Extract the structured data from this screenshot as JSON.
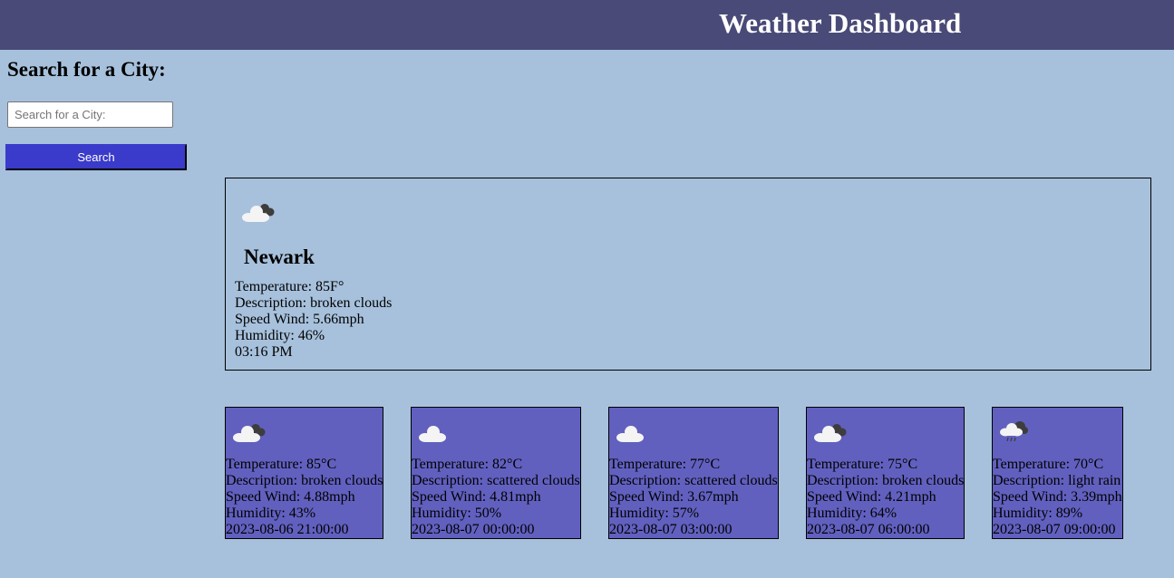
{
  "header": {
    "title": "Weather Dashboard"
  },
  "search": {
    "heading": "Search for a City:",
    "placeholder": "Search for a City:",
    "value": "",
    "button_label": "Search"
  },
  "current": {
    "icon": "broken-clouds-icon",
    "city": "Newark",
    "temperature": "Temperature: 85F°",
    "description": "Description: broken clouds",
    "wind": "Speed Wind: 5.66mph",
    "humidity": "Humidity: 46%",
    "time": "03:16 PM"
  },
  "forecast": [
    {
      "icon": "broken-clouds-icon",
      "temperature": "Temperature: 85°C",
      "description": "Description: broken clouds",
      "wind": "Speed Wind: 4.88mph",
      "humidity": "Humidity: 43%",
      "datetime": "2023-08-06 21:00:00"
    },
    {
      "icon": "scattered-clouds-icon",
      "temperature": "Temperature: 82°C",
      "description": "Description: scattered clouds",
      "wind": "Speed Wind: 4.81mph",
      "humidity": "Humidity: 50%",
      "datetime": "2023-08-07 00:00:00"
    },
    {
      "icon": "scattered-clouds-icon",
      "temperature": "Temperature: 77°C",
      "description": "Description: scattered clouds",
      "wind": "Speed Wind: 3.67mph",
      "humidity": "Humidity: 57%",
      "datetime": "2023-08-07 03:00:00"
    },
    {
      "icon": "broken-clouds-icon",
      "temperature": "Temperature: 75°C",
      "description": "Description: broken clouds",
      "wind": "Speed Wind: 4.21mph",
      "humidity": "Humidity: 64%",
      "datetime": "2023-08-07 06:00:00"
    },
    {
      "icon": "light-rain-icon",
      "temperature": "Temperature: 70°C",
      "description": "Description: light rain",
      "wind": "Speed Wind: 3.39mph",
      "humidity": "Humidity: 89%",
      "datetime": "2023-08-07 09:00:00"
    }
  ],
  "colors": {
    "page_background": "#a7c1dc",
    "header_background": "#494a77",
    "button_background": "#3a3acb",
    "forecast_card_background": "#6160bf"
  }
}
